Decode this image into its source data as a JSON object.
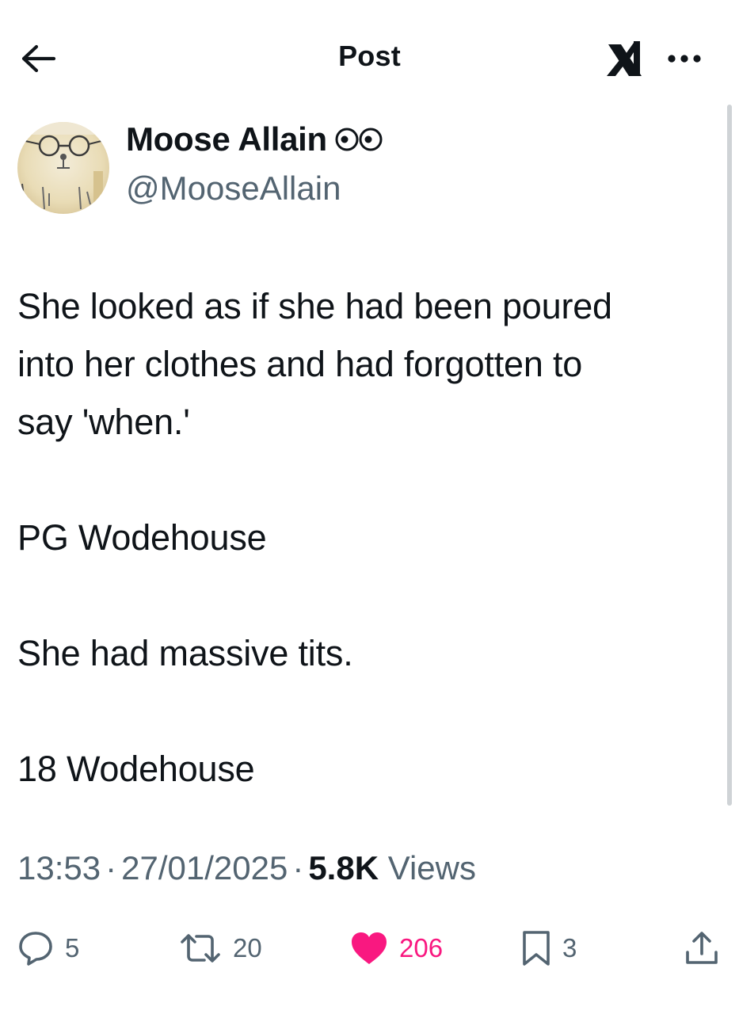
{
  "header": {
    "title": "Post"
  },
  "author": {
    "name": "Moose Allain",
    "handle": "@MooseAllain"
  },
  "tweet": {
    "lines": [
      "She looked as if she had been poured",
      "into her clothes and had forgotten to",
      "say 'when.'",
      "",
      "PG Wodehouse",
      "",
      "She had massive tits.",
      "",
      "18 Wodehouse"
    ]
  },
  "meta": {
    "time": "13:53",
    "separator": "·",
    "date": "27/01/2025",
    "views_count": "5.8K",
    "views_label": "Views"
  },
  "actions": {
    "replies": "5",
    "reposts": "20",
    "likes": "206",
    "bookmarks": "3"
  },
  "colors": {
    "text": "#0f1419",
    "secondary": "#536471",
    "like": "#f91880"
  },
  "icons": [
    "back-arrow-icon",
    "grok-icon",
    "more-icon",
    "glasses-badge-icon",
    "reply-icon",
    "repost-icon",
    "heart-icon",
    "bookmark-icon",
    "share-icon"
  ]
}
